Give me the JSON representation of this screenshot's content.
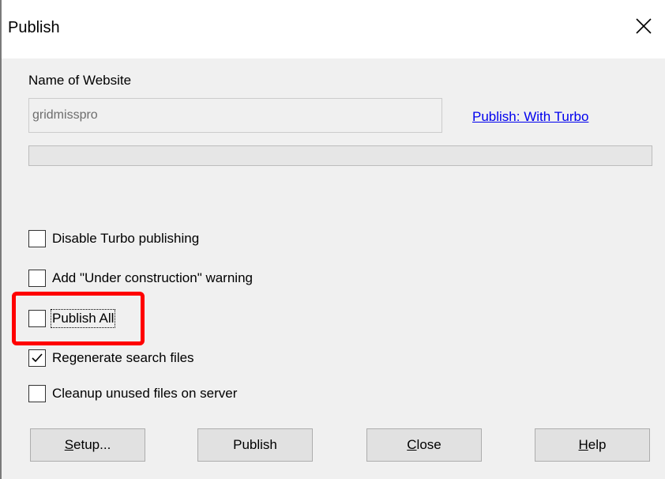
{
  "window": {
    "title": "Publish",
    "close_icon": "close-icon"
  },
  "form": {
    "name_label": "Name of Website",
    "website_name": "gridmisspro",
    "turbo_link": "Publish: With Turbo",
    "progress": 0
  },
  "options": [
    {
      "label": "Disable Turbo publishing",
      "checked": false
    },
    {
      "label": "Add \"Under construction\" warning",
      "checked": false
    },
    {
      "label": "Publish All",
      "checked": false
    },
    {
      "label": "Regenerate search files",
      "checked": true
    },
    {
      "label": "Cleanup unused files on server",
      "checked": false
    }
  ],
  "buttons": {
    "setup": {
      "mnemonic": "S",
      "rest": "etup..."
    },
    "publish": {
      "label": "Publish"
    },
    "close": {
      "mnemonic": "C",
      "rest": "lose"
    },
    "help": {
      "mnemonic": "H",
      "rest": "elp"
    }
  },
  "colors": {
    "highlight": "#ff0000",
    "link": "#0000ee"
  }
}
